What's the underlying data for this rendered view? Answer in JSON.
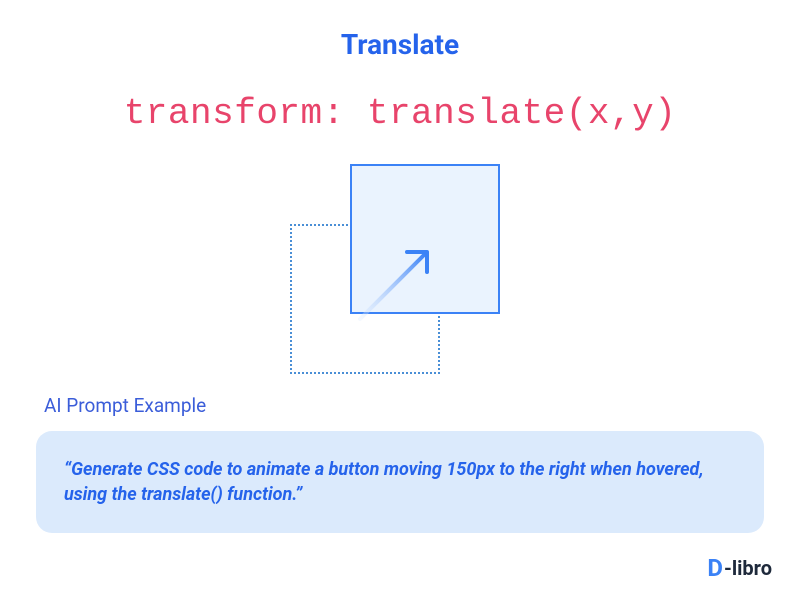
{
  "title": "Translate",
  "code_syntax": "transform: translate(x,y)",
  "section_label": "AI Prompt Example",
  "prompt_text": "“Generate CSS code to animate a button moving 150px to the right when hovered, using the translate() function.”",
  "logo": {
    "prefix": "D",
    "text": "-libro"
  }
}
